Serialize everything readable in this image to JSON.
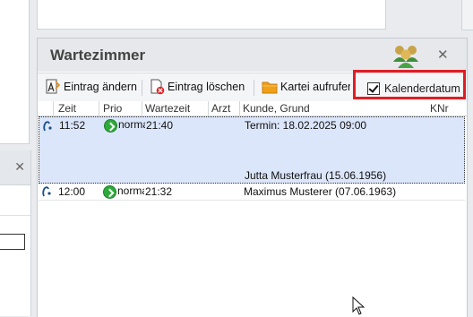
{
  "panel": {
    "title": "Wartezimmer",
    "close_glyph": "✕"
  },
  "toolbar": {
    "edit_label": "Eintrag ändern",
    "delete_label": "Eintrag löschen",
    "file_label": "Kartei aufrufen",
    "calendar_label": "Kalenderdatum",
    "calendar_checked": true
  },
  "columns": {
    "zeit": "Zeit",
    "prio": "Prio",
    "wartezeit": "Wartezeit",
    "arzt": "Arzt",
    "kunde": "Kunde, Grund",
    "knr": "KNr"
  },
  "rows": [
    {
      "zeit": "11:52",
      "prio": "normal",
      "wartezeit": "21:40",
      "arzt": "",
      "termin": "Termin: 18.02.2025 09:00",
      "kunde": "Jutta Musterfrau (15.06.1956)"
    },
    {
      "zeit": "12:00",
      "prio": "normal",
      "wartezeit": "21:32",
      "arzt": "",
      "kunde": "Maximus Musterer (07.06.1963)"
    }
  ],
  "left_panel": {
    "close_glyph": "✕"
  },
  "colors": {
    "selected_row": "#dce6fa",
    "highlight_box": "#e11d24",
    "prio_green": "#2eaa3a"
  }
}
